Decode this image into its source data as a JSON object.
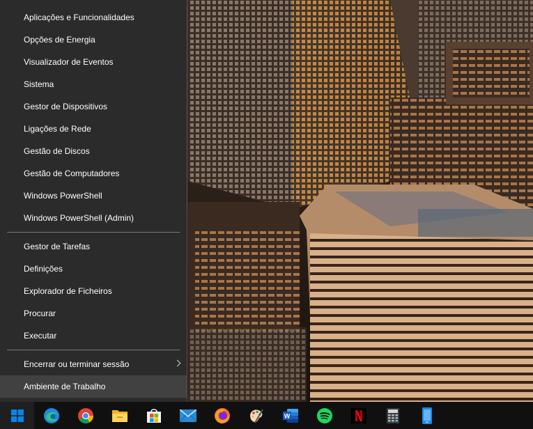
{
  "menu": {
    "group1": [
      {
        "label": "Aplicações e Funcionalidades"
      },
      {
        "label": "Opções de Energia"
      },
      {
        "label": "Visualizador de Eventos"
      },
      {
        "label": "Sistema"
      },
      {
        "label": "Gestor de Dispositivos"
      },
      {
        "label": "Ligações de Rede"
      },
      {
        "label": "Gestão de Discos"
      },
      {
        "label": "Gestão de Computadores"
      },
      {
        "label": "Windows PowerShell"
      },
      {
        "label": "Windows PowerShell (Admin)"
      }
    ],
    "group2": [
      {
        "label": "Gestor de Tarefas"
      },
      {
        "label": "Definições"
      },
      {
        "label": "Explorador de Ficheiros"
      },
      {
        "label": "Procurar"
      },
      {
        "label": "Executar"
      }
    ],
    "group3": [
      {
        "label": "Encerrar ou terminar sessão",
        "has_submenu": true
      },
      {
        "label": "Ambiente de Trabalho",
        "highlighted": true
      }
    ]
  },
  "taskbar": {
    "items": [
      {
        "name": "windows-start-icon"
      },
      {
        "name": "edge-icon"
      },
      {
        "name": "chrome-icon"
      },
      {
        "name": "file-explorer-icon"
      },
      {
        "name": "microsoft-store-icon"
      },
      {
        "name": "mail-icon"
      },
      {
        "name": "firefox-icon"
      },
      {
        "name": "paint-icon"
      },
      {
        "name": "word-icon"
      },
      {
        "name": "spotify-icon"
      },
      {
        "name": "netflix-icon"
      },
      {
        "name": "calculator-icon"
      },
      {
        "name": "phone-link-icon"
      }
    ]
  },
  "colors": {
    "menu_bg": "#2b2b2b",
    "menu_hover": "#414141",
    "menu_text": "#ffffff",
    "taskbar_bg": "#101010",
    "windows_blue": "#0078d7"
  }
}
